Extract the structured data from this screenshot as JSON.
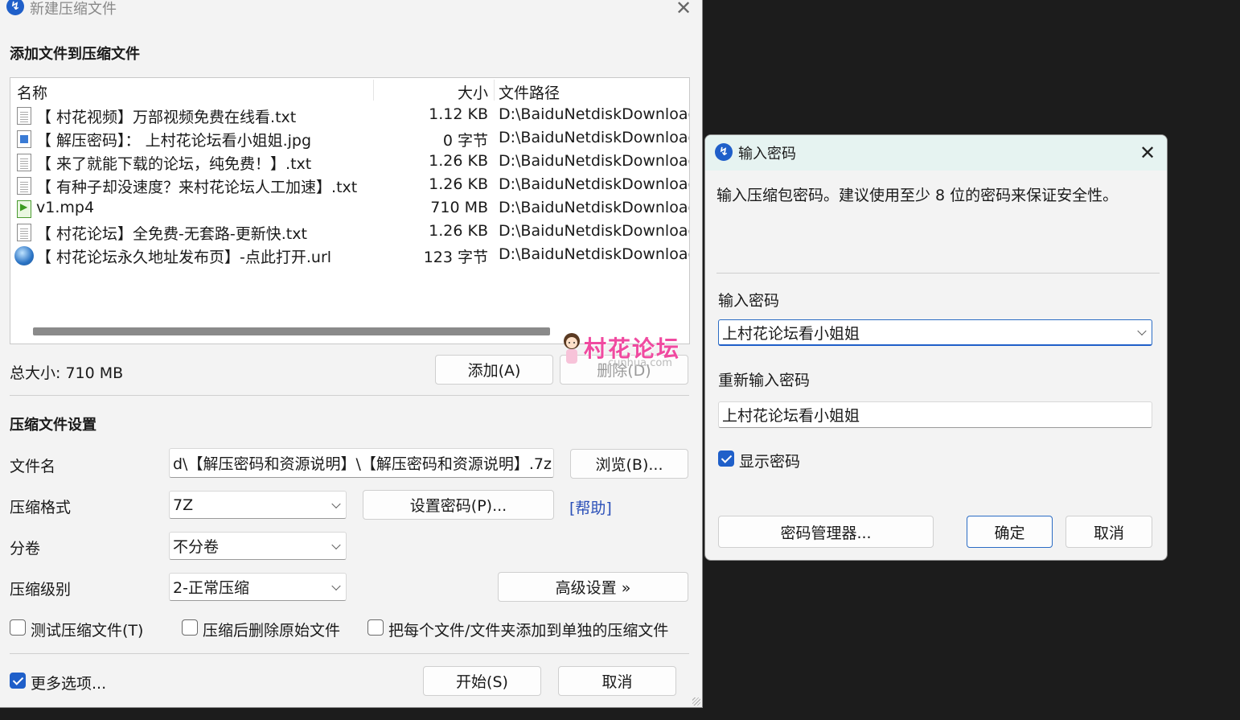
{
  "main_window": {
    "title": "新建压缩文件",
    "section_add": "添加文件到压缩文件",
    "columns": {
      "name": "名称",
      "size": "大小",
      "path": "文件路径"
    },
    "files": [
      {
        "name": "【 村花视频】万部视频免费在线看.txt",
        "size": "1.12 KB",
        "path": "D:\\BaiduNetdiskDownload",
        "icon": "text-file-icon"
      },
      {
        "name": "【 解压密码】： 上村花论坛看小姐姐.jpg",
        "size": "0 字节",
        "path": "D:\\BaiduNetdiskDownload",
        "icon": "image-file-icon"
      },
      {
        "name": "【 来了就能下载的论坛，纯免费！】.txt",
        "size": "1.26 KB",
        "path": "D:\\BaiduNetdiskDownload",
        "icon": "text-file-icon"
      },
      {
        "name": "【 有种子却没速度？来村花论坛人工加速】.txt",
        "size": "1.26 KB",
        "path": "D:\\BaiduNetdiskDownload",
        "icon": "text-file-icon"
      },
      {
        "name": "v1.mp4",
        "size": "710 MB",
        "path": "D:\\BaiduNetdiskDownload",
        "icon": "video-file-icon"
      },
      {
        "name": "【 村花论坛】全免费-无套路-更新快.txt",
        "size": "1.26 KB",
        "path": "D:\\BaiduNetdiskDownload",
        "icon": "text-file-icon"
      },
      {
        "name": "【 村花论坛永久地址发布页】-点此打开.url",
        "size": "123 字节",
        "path": "D:\\BaiduNetdiskDownload",
        "icon": "globe-icon"
      }
    ],
    "total_size": "总大小: 710 MB",
    "add_button": "添加(A)",
    "delete_button": "删除(D)",
    "section_settings": "压缩文件设置",
    "filename_label": "文件名",
    "filename_value": "d\\【解压密码和资源说明】\\【解压密码和资源说明】.7z",
    "browse_button": "浏览(B)...",
    "format_label": "压缩格式",
    "format_value": "7Z",
    "set_password_button": "设置密码(P)...",
    "help_link": "[帮助]",
    "split_label": "分卷",
    "split_value": "不分卷",
    "level_label": "压缩级别",
    "level_value": "2-正常压缩",
    "advanced_button": "高级设置 »",
    "test_checkbox": "测试压缩文件(T)",
    "delete_original_checkbox": "压缩后删除原始文件",
    "separate_checkbox": "把每个文件/文件夹添加到单独的压缩文件",
    "more_options_checkbox": "更多选项...",
    "start_button": "开始(S)",
    "cancel_button": "取消"
  },
  "watermark": {
    "text": "村花论坛",
    "sub": "cunhua.com"
  },
  "password_dialog": {
    "title": "输入密码",
    "message": "输入压缩包密码。建议使用至少 8 位的密码来保证安全性。",
    "password_label": "输入密码",
    "password_value": "上村花论坛看小姐姐",
    "reenter_label": "重新输入密码",
    "reenter_value": "上村花论坛看小姐姐",
    "show_password": "显示密码",
    "manager_button": "密码管理器...",
    "ok_button": "确定",
    "cancel_button": "取消"
  },
  "colors": {
    "accent": "#1f5fc9",
    "link": "#2a4fb8",
    "dialog_titlebar": "#e6f3f1",
    "watermark": "#f04aa0"
  }
}
